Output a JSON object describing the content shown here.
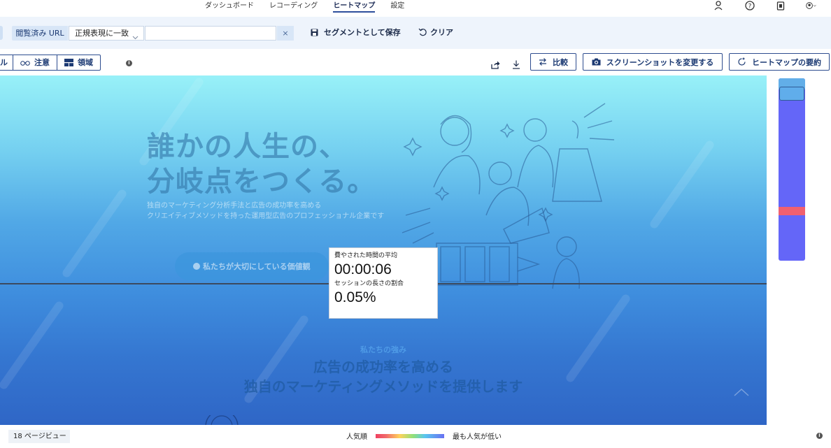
{
  "nav": {
    "links": [
      "ダッシュボード",
      "レコーディング",
      "ヒートマップ",
      "設定"
    ],
    "active_index": 2
  },
  "segment": {
    "url_label": "閲覧済み URL",
    "match_type": "正規表現に一致",
    "url_value": "",
    "clear_x": "×",
    "save_label": "セグメントとして保存",
    "clear_label": "クリア"
  },
  "toolbar": {
    "modes": [
      "ル",
      "注意",
      "領域"
    ],
    "compare_label": "比較",
    "change_screenshot_label": "スクリーンショットを変更する",
    "summary_label": "ヒートマップの要約",
    "info": "i"
  },
  "page": {
    "hero_line1": "誰かの人生の、",
    "hero_line2": "分岐点をつくる。",
    "sub_line1": "独自のマーケティング分析手法と広告の成功率を高める",
    "sub_line2": "クリエイティブメソッドを持った運用型広告のプロフェッショナル企業です",
    "cta_label": "私たちが大切にしている価値観",
    "strength_kicker": "私たちの強み",
    "strength_line1": "広告の成功率を高める",
    "strength_line2": "独自のマーケティングメソッドを提供します"
  },
  "tooltip": {
    "avg_time_label": "費やされた時間の平均",
    "avg_time_value": "00:00:06",
    "session_share_label": "セッションの長さの割合",
    "session_share_value": "0.05%"
  },
  "footer": {
    "pageviews": "18 ページビュー",
    "legend_high": "人気順",
    "legend_low": "最も人気が低い",
    "info": "i"
  },
  "colors": {
    "accent": "#2e4d8f",
    "heat_top": "#98f1f8",
    "heat_bottom": "#2f66c6",
    "minimap_cold": "#6466f8",
    "minimap_hot": "#f06070"
  }
}
